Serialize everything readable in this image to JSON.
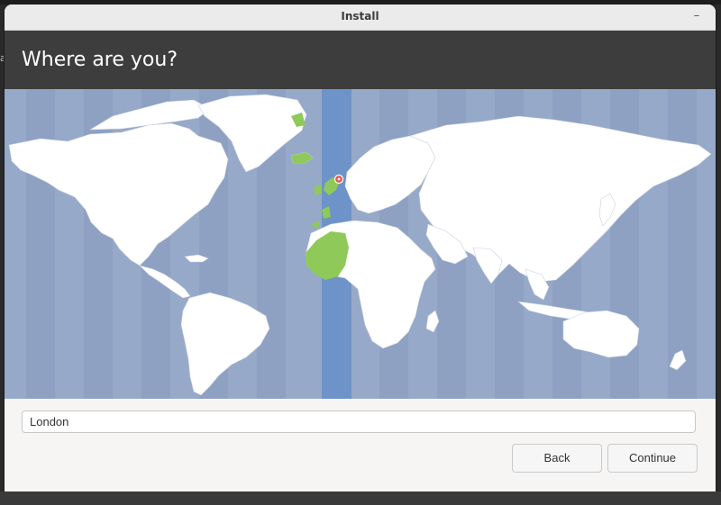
{
  "window": {
    "title": "Install",
    "minimize_glyph": "–"
  },
  "page": {
    "title": "Where are you?"
  },
  "location": {
    "value": "London",
    "placeholder": ""
  },
  "buttons": {
    "back_label": "Back",
    "continue_label": "Continue"
  },
  "background": {
    "edge_text": "a"
  },
  "map": {
    "ocean_color": "#97a9c9",
    "land_color": "#ffffff",
    "selected_zone_color": "#6e93c9",
    "highlight_land_color": "#8fc95a",
    "pin_color": "#e05a4c"
  }
}
